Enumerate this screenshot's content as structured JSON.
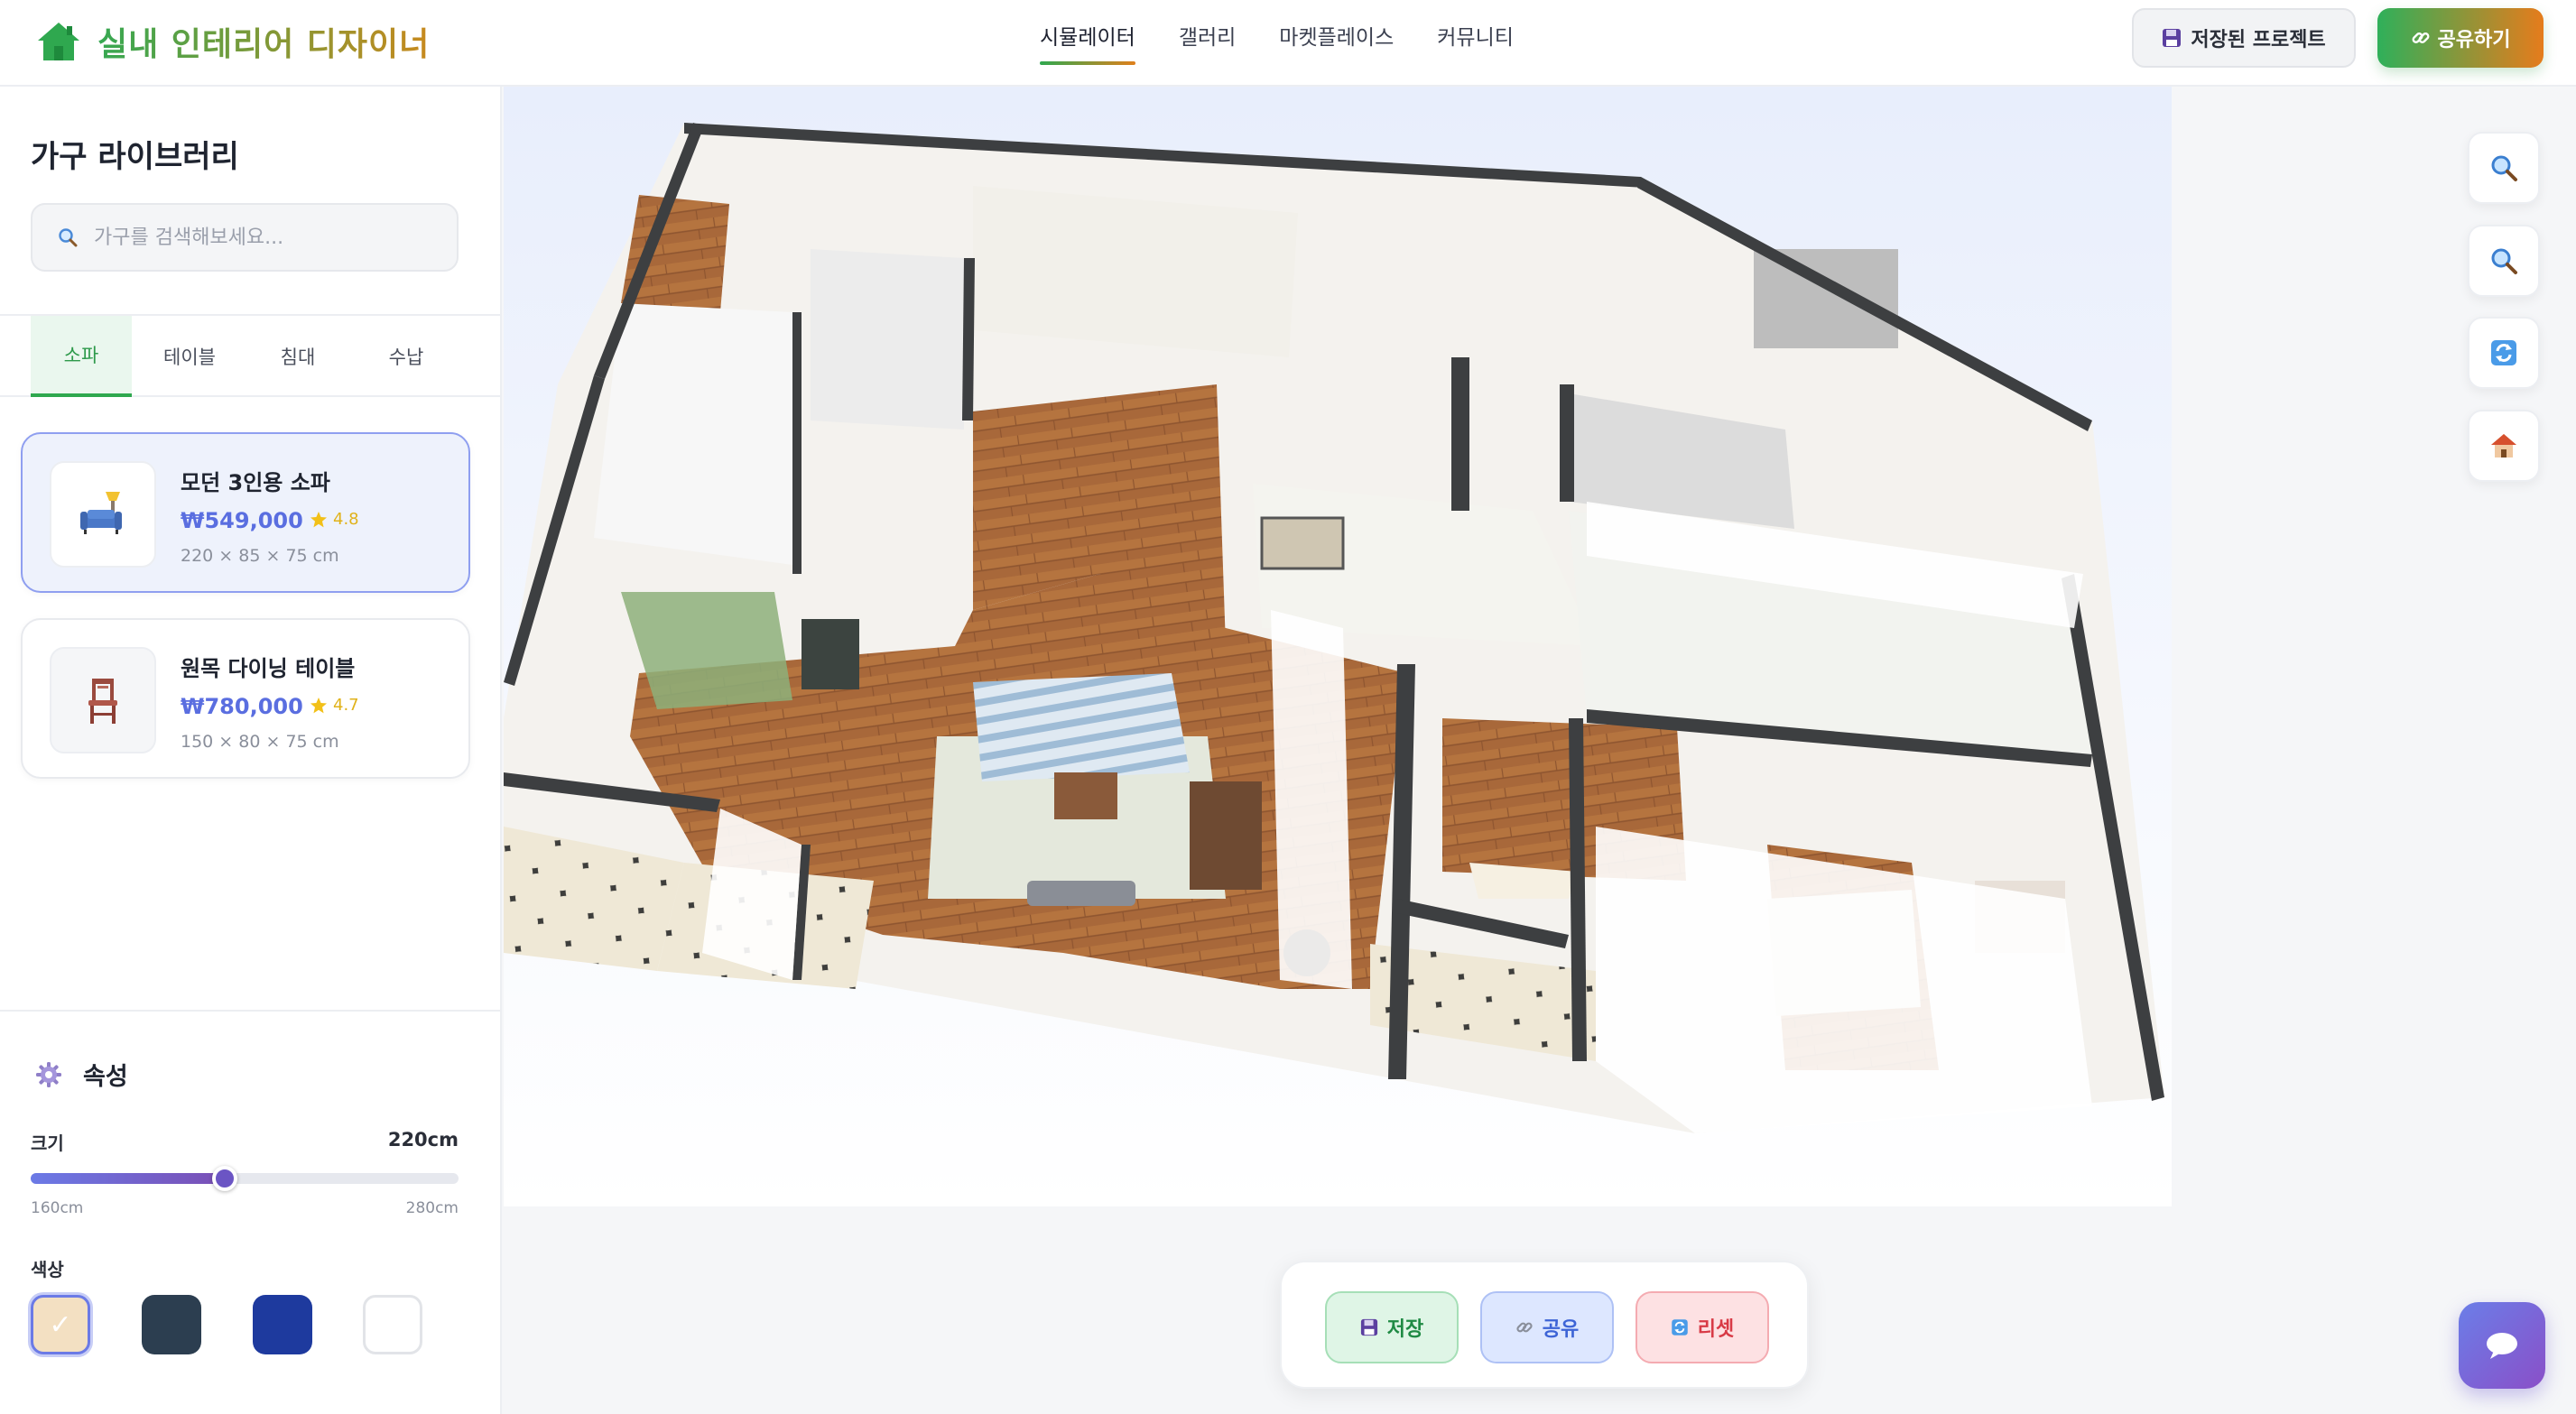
{
  "header": {
    "app_title": "실내 인테리어 디자이너",
    "nav": [
      "시뮬레이터",
      "갤러리",
      "마켓플레이스",
      "커뮤니티"
    ],
    "active_nav": "시뮬레이터",
    "saved_projects_label": "저장된 프로젝트",
    "share_label": "공유하기"
  },
  "sidebar": {
    "title": "가구 라이브러리",
    "search_placeholder": "가구를 검색해보세요...",
    "tabs": [
      "소파",
      "테이블",
      "침대",
      "수납"
    ],
    "active_tab": "소파",
    "items": [
      {
        "name": "모던 3인용 소파",
        "price": "₩549,000",
        "rating": "4.8",
        "dims": "220 × 85 × 75 cm",
        "icon": "sofa-icon",
        "selected": true
      },
      {
        "name": "원목 다이닝 테이블",
        "price": "₩780,000",
        "rating": "4.7",
        "dims": "150 × 80 × 75 cm",
        "icon": "chair-icon",
        "selected": false
      }
    ]
  },
  "properties": {
    "title": "속성",
    "size_label": "크기",
    "size_value": "220cm",
    "size_min": "160cm",
    "size_max": "280cm",
    "size_fraction": 0.5,
    "color_label": "색상",
    "colors": [
      "#f3e0c2",
      "#2c3e50",
      "#1e3a9e",
      "#ffffff"
    ],
    "selected_color_index": 0,
    "selected_check": "✓"
  },
  "tools": {
    "zoom_in": "magnifier-icon",
    "zoom_out": "magnifier-icon",
    "rotate": "rotate-icon",
    "home": "house-icon"
  },
  "actions": {
    "save_label": "저장",
    "share_label": "공유",
    "reset_label": "리셋"
  },
  "colors": {
    "accent_green": "#2fa84f",
    "accent_orange": "#e57c1c",
    "accent_purple": "#6b7ae6"
  }
}
